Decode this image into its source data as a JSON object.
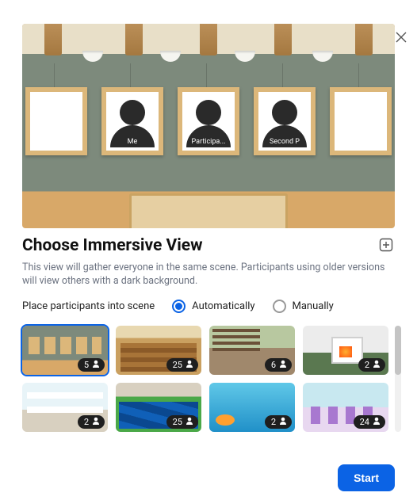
{
  "title": "Choose Immersive View",
  "subtitle": "This view will gather everyone in the same scene. Participants using older versions will view others with a dark background.",
  "placement_label": "Place participants into scene",
  "radio": {
    "auto": "Automatically",
    "manual": "Manually",
    "selected": "auto"
  },
  "start_label": "Start",
  "preview_participants": [
    {
      "label": ""
    },
    {
      "label": "Me"
    },
    {
      "label": "Participa..."
    },
    {
      "label": "Second P"
    },
    {
      "label": ""
    }
  ],
  "scenes": [
    {
      "id": "gallery",
      "capacity": 5,
      "selected": true
    },
    {
      "id": "classroom",
      "capacity": 25,
      "selected": false
    },
    {
      "id": "cafe",
      "capacity": 6,
      "selected": false
    },
    {
      "id": "fireplace",
      "capacity": 2,
      "selected": false
    },
    {
      "id": "kitchen",
      "capacity": 2,
      "selected": false
    },
    {
      "id": "stadium",
      "capacity": 25,
      "selected": false
    },
    {
      "id": "underwater",
      "capacity": 2,
      "selected": false
    },
    {
      "id": "learning",
      "capacity": 24,
      "selected": false
    }
  ]
}
